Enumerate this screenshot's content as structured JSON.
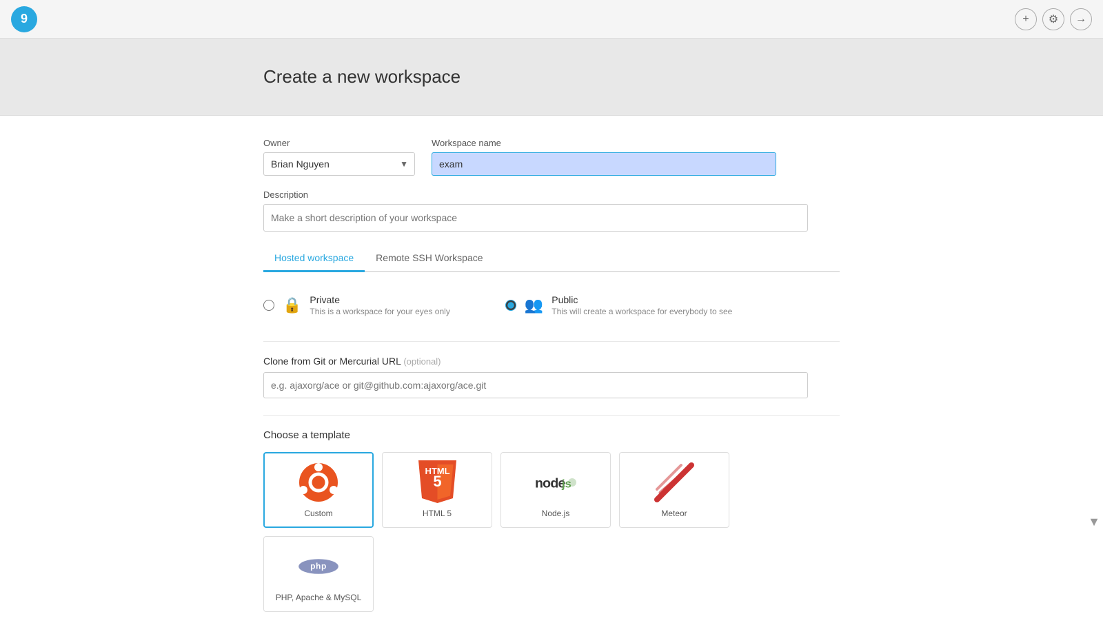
{
  "topbar": {
    "logo_text": "9",
    "actions": {
      "add_label": "+",
      "settings_label": "⚙",
      "signout_label": "→"
    }
  },
  "page": {
    "title": "Create a new workspace"
  },
  "form": {
    "owner_label": "Owner",
    "owner_value": "Brian Nguyen",
    "owner_options": [
      "Brian Nguyen"
    ],
    "workspace_name_label": "Workspace name",
    "workspace_name_value": "exam",
    "description_label": "Description",
    "description_placeholder": "Make a short description of your workspace"
  },
  "tabs": [
    {
      "id": "hosted",
      "label": "Hosted workspace",
      "active": true
    },
    {
      "id": "ssh",
      "label": "Remote SSH Workspace",
      "active": false
    }
  ],
  "privacy": {
    "options": [
      {
        "id": "private",
        "label": "Private",
        "description": "This is a workspace for your eyes only",
        "checked": false
      },
      {
        "id": "public",
        "label": "Public",
        "description": "This will create a workspace for everybody to see",
        "checked": true
      }
    ]
  },
  "clone": {
    "label": "Clone from Git or Mercurial URL",
    "optional_text": "(optional)",
    "placeholder": "e.g. ajaxorg/ace or git@github.com:ajaxorg/ace.git"
  },
  "templates": {
    "section_label": "Choose a template",
    "items": [
      {
        "id": "custom",
        "name": "Custom",
        "type": "ubuntu"
      },
      {
        "id": "html5",
        "name": "HTML 5",
        "type": "html5"
      },
      {
        "id": "nodejs",
        "name": "Node.js",
        "type": "nodejs"
      },
      {
        "id": "meteor",
        "name": "Meteor",
        "type": "meteor"
      },
      {
        "id": "php",
        "name": "PHP, Apache & MySQL",
        "type": "php"
      }
    ]
  }
}
